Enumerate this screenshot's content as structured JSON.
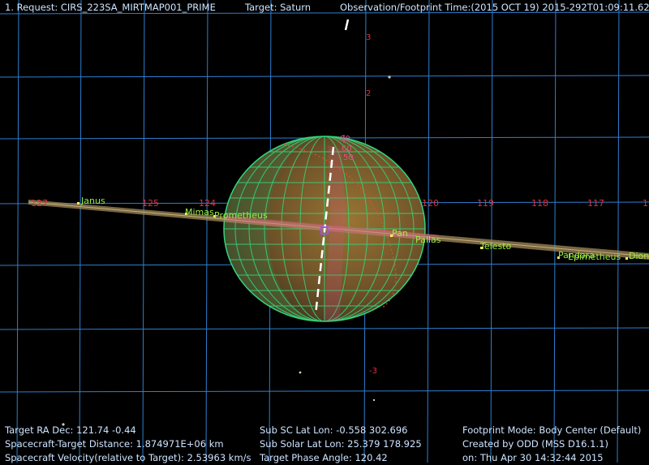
{
  "header": {
    "request": "1. Request: CIRS_223SA_MIRTMAP001_PRIME",
    "target": "Target: Saturn",
    "time": "Observation/Footprint Time:(2015 OCT 19) 2015-292T01:09:11.62"
  },
  "grid": {
    "ra_labels": [
      "127",
      "125",
      "124",
      "120",
      "119",
      "118",
      "117",
      "1"
    ],
    "dec_labels": [
      "3",
      "2",
      "-3"
    ],
    "lat_labels": [
      "80",
      "60",
      "50"
    ]
  },
  "moons": [
    "Janus",
    "Mimas",
    "Prometheus",
    "Pan",
    "Pallas",
    "Telesto",
    "Pandora",
    "Epimetheus",
    "Dione"
  ],
  "info": {
    "left": [
      "Target RA Dec: 121.74   -0.44",
      "Spacecraft-Target Distance: 1.874971E+06 km",
      "Spacecraft Velocity(relative to Target): 2.53963 km/s"
    ],
    "middle": [
      "Sub SC Lat Lon: -0.558  302.696",
      "Sub Solar Lat Lon: 25.379  178.925",
      "Target Phase Angle: 120.42"
    ],
    "right": [
      "Footprint Mode: Body Center (Default)",
      "Created by ODD (MSS D16.1.1)",
      "on: Thu Apr 30 14:32:44 2015"
    ]
  },
  "colors": {
    "grid": "#2f7fd0",
    "planet_lit": "#7a5a2c",
    "planet_dark": "#3a2e1a",
    "planet_grid": "#35d47a",
    "ring": "#a08a5a",
    "footprint": "#e0508a",
    "moon_label": "#9aee40",
    "ra_label": "#e03040"
  }
}
